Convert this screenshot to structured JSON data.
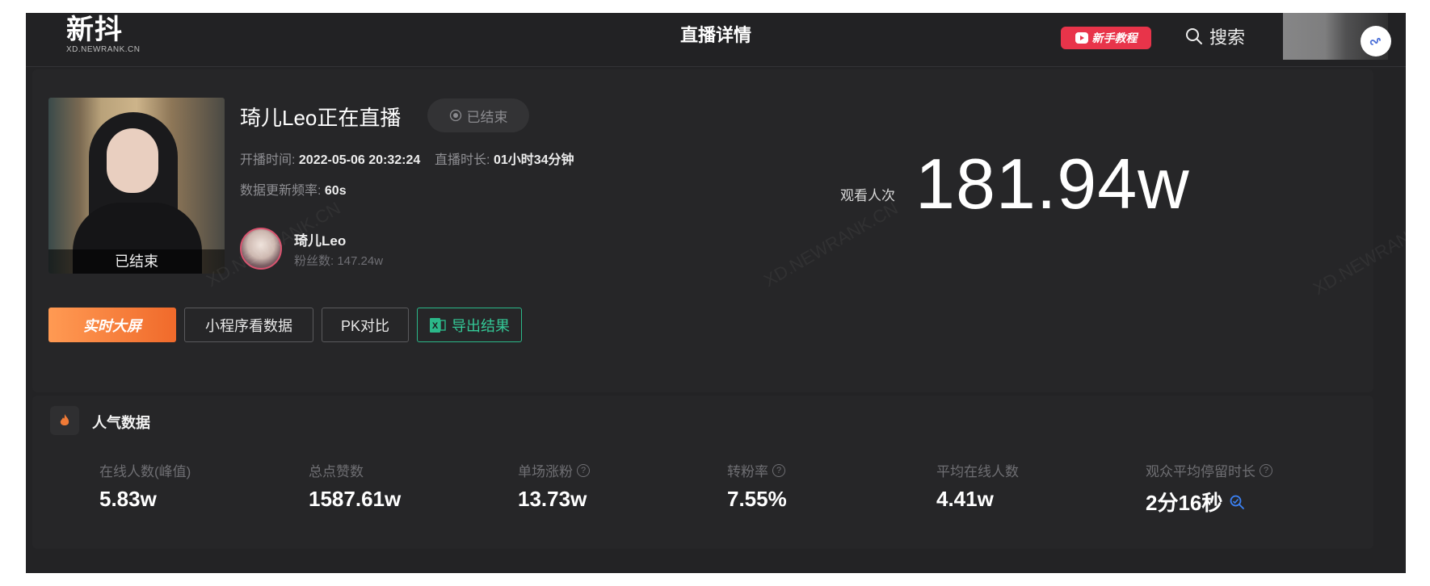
{
  "header": {
    "logo_main": "新抖",
    "logo_sub": "XD.NEWRANK.CN",
    "page_title": "直播详情",
    "tutorial_label": "新手教程",
    "search_label": "搜索"
  },
  "live": {
    "stream_name": "琦儿Leo正在直播",
    "status_label": "已结束",
    "thumb_overlay": "已结束",
    "start_label": "开播时间:",
    "start_value": "2022-05-06 20:32:24",
    "duration_label": "直播时长:",
    "duration_value": "01小时34分钟",
    "refresh_label": "数据更新频率:",
    "refresh_value": "60s",
    "host_name": "琦儿Leo",
    "host_fans_label": "粉丝数:",
    "host_fans_value": "147.24w",
    "views_label": "观看人次",
    "views_value": "181.94w"
  },
  "actions": {
    "realtime_label": "实时大屏",
    "miniapp_label": "小程序看数据",
    "pk_label": "PK对比",
    "export_label": "导出结果"
  },
  "watermark": "XD.NEWRANK.CN",
  "popularity": {
    "title": "人气数据",
    "metrics": [
      {
        "label": "在线人数(峰值)",
        "value": "5.83w"
      },
      {
        "label": "总点赞数",
        "value": "1587.61w"
      },
      {
        "label": "单场涨粉",
        "value": "13.73w"
      },
      {
        "label": "转粉率",
        "value": "7.55%"
      },
      {
        "label": "平均在线人数",
        "value": "4.41w"
      },
      {
        "label": "观众平均停留时长",
        "value": "2分16秒"
      }
    ]
  },
  "colors": {
    "accent_orange": "#f06a2b",
    "export_green": "#2bb889",
    "badge_red": "#e8344a",
    "background": "#232325"
  },
  "icons": [
    "play-icon",
    "search-icon",
    "mini-program-link-icon",
    "radio-dot-icon",
    "excel-icon",
    "flame-icon",
    "help-icon",
    "magnify-icon"
  ]
}
